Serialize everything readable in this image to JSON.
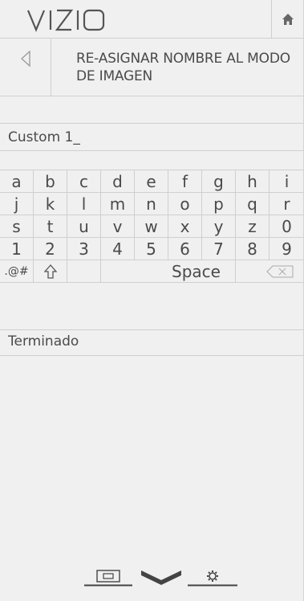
{
  "header": {
    "logo_text": "VIZIO",
    "home_icon": "home-icon"
  },
  "title": {
    "back_icon": "back-arrow-icon",
    "text": "RE-ASIGNAR NOMBRE AL MODO DE IMAGEN"
  },
  "input": {
    "value": "Custom 1_"
  },
  "keyboard": {
    "rows": [
      [
        "a",
        "b",
        "c",
        "d",
        "e",
        "f",
        "g",
        "h",
        "i"
      ],
      [
        "j",
        "k",
        "l",
        "m",
        "n",
        "o",
        "p",
        "q",
        "r"
      ],
      [
        "s",
        "t",
        "u",
        "v",
        "w",
        "x",
        "y",
        "z",
        "0"
      ],
      [
        "1",
        "2",
        "3",
        "4",
        "5",
        "6",
        "7",
        "8",
        "9"
      ]
    ],
    "symbols_key": ".@#",
    "shift_icon": "shift-icon",
    "space_key": "Space",
    "backspace_icon": "backspace-icon"
  },
  "done_label": "Terminado",
  "footer": {
    "icons": [
      "picture-input-icon",
      "vizio-chevron-icon",
      "settings-icon"
    ]
  },
  "colors": {
    "background": "#f0f0f0",
    "divider": "#cfcfcf",
    "text": "#4a4a4a"
  }
}
